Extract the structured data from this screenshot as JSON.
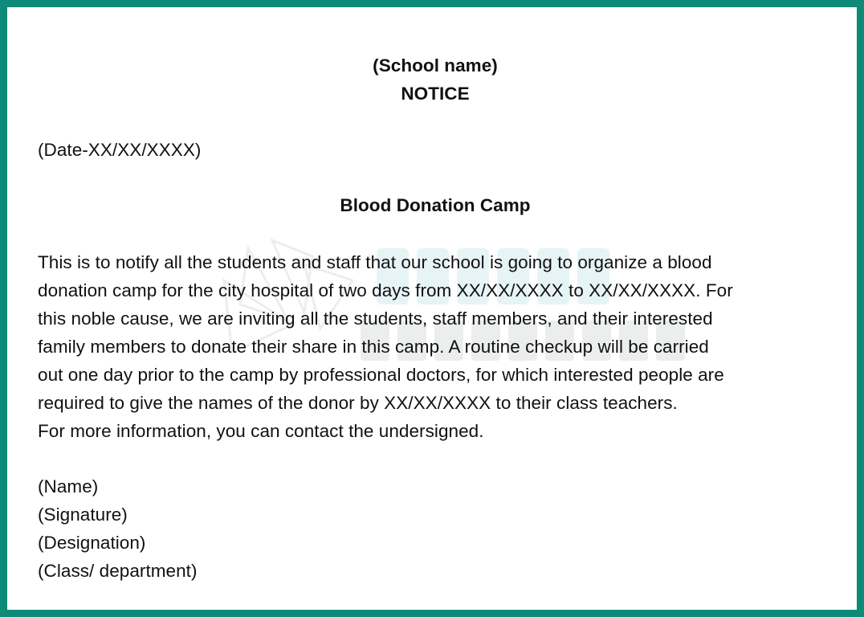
{
  "notice": {
    "school_name": "(School name)",
    "heading": "NOTICE",
    "date": "(Date-XX/XX/XXXX)",
    "subject": "Blood Donation Camp",
    "body_lines": [
      "This is to notify all the students and staff that our school is going to organize a blood",
      "donation camp for the city hospital of two days from XX/XX/XXXX to XX/XX/XXXX. For",
      "this noble cause, we are inviting all the students, staff members, and their interested",
      "family members to donate their share in this camp. A routine checkup will be carried",
      "out one day prior to the camp by professional doctors, for which interested people are",
      "required to give the names of the donor by XX/XX/XXXX to their class teachers.",
      "For more information, you can contact the undersigned."
    ],
    "signoff": {
      "name": "(Name)",
      "signature": "(Signature)",
      "designation": "(Designation)",
      "class_department": "(Class/ department)"
    }
  },
  "colors": {
    "border": "#0e8a78",
    "text": "#111111",
    "background": "#ffffff"
  }
}
